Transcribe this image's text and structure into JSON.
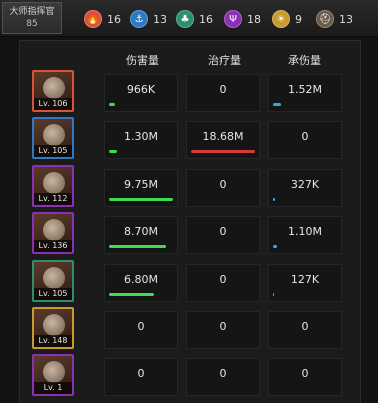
{
  "rank": {
    "label": "大师指挥官",
    "value": "85"
  },
  "factions": [
    {
      "name": "fire-faction-icon",
      "color": "#d9533a",
      "count": "16"
    },
    {
      "name": "anchor-faction-icon",
      "color": "#2f79c2",
      "count": "13"
    },
    {
      "name": "tree-faction-icon",
      "color": "#2d8f6e",
      "count": "16"
    },
    {
      "name": "trident-faction-icon",
      "color": "#8b2fb4",
      "count": "18"
    },
    {
      "name": "sun-faction-icon",
      "color": "#c99b2a",
      "count": "9"
    },
    {
      "name": "helmet-faction-icon",
      "color": "#6b5a4a",
      "count": "13"
    }
  ],
  "headers": {
    "damage": "伤害量",
    "heal": "治疗量",
    "taken": "承伤量"
  },
  "colors": {
    "damage": "#3ddc4f",
    "heal": "#d43a3a",
    "taken": "#37a9e0"
  },
  "heroes": [
    {
      "level": "Lv. 106",
      "damage": "966K",
      "heal": "0",
      "taken": "1.52M",
      "damage_frac": 0.09,
      "heal_frac": 0,
      "taken_frac": 0.12,
      "frame": "#d9533a"
    },
    {
      "level": "Lv. 105",
      "damage": "1.30M",
      "heal": "18.68M",
      "taken": "0",
      "damage_frac": 0.12,
      "heal_frac": 0.97,
      "taken_frac": 0,
      "frame": "#2f79c2"
    },
    {
      "level": "Lv. 112",
      "damage": "9.75M",
      "heal": "0",
      "taken": "327K",
      "damage_frac": 0.97,
      "heal_frac": 0,
      "taken_frac": 0.03,
      "frame": "#8b2fb4"
    },
    {
      "level": "Lv. 136",
      "damage": "8.70M",
      "heal": "0",
      "taken": "1.10M",
      "damage_frac": 0.87,
      "heal_frac": 0,
      "taken_frac": 0.06,
      "frame": "#8b2fb4"
    },
    {
      "level": "Lv. 105",
      "damage": "6.80M",
      "heal": "0",
      "taken": "127K",
      "damage_frac": 0.68,
      "heal_frac": 0,
      "taken_frac": 0.01,
      "frame": "#2d8f6e"
    },
    {
      "level": "Lv. 148",
      "damage": "0",
      "heal": "0",
      "taken": "0",
      "damage_frac": 0,
      "heal_frac": 0,
      "taken_frac": 0,
      "frame": "#c99b2a"
    },
    {
      "level": "Lv. 1",
      "damage": "0",
      "heal": "0",
      "taken": "0",
      "damage_frac": 0,
      "heal_frac": 0,
      "taken_frac": 0,
      "frame": "#8b2fb4"
    }
  ]
}
